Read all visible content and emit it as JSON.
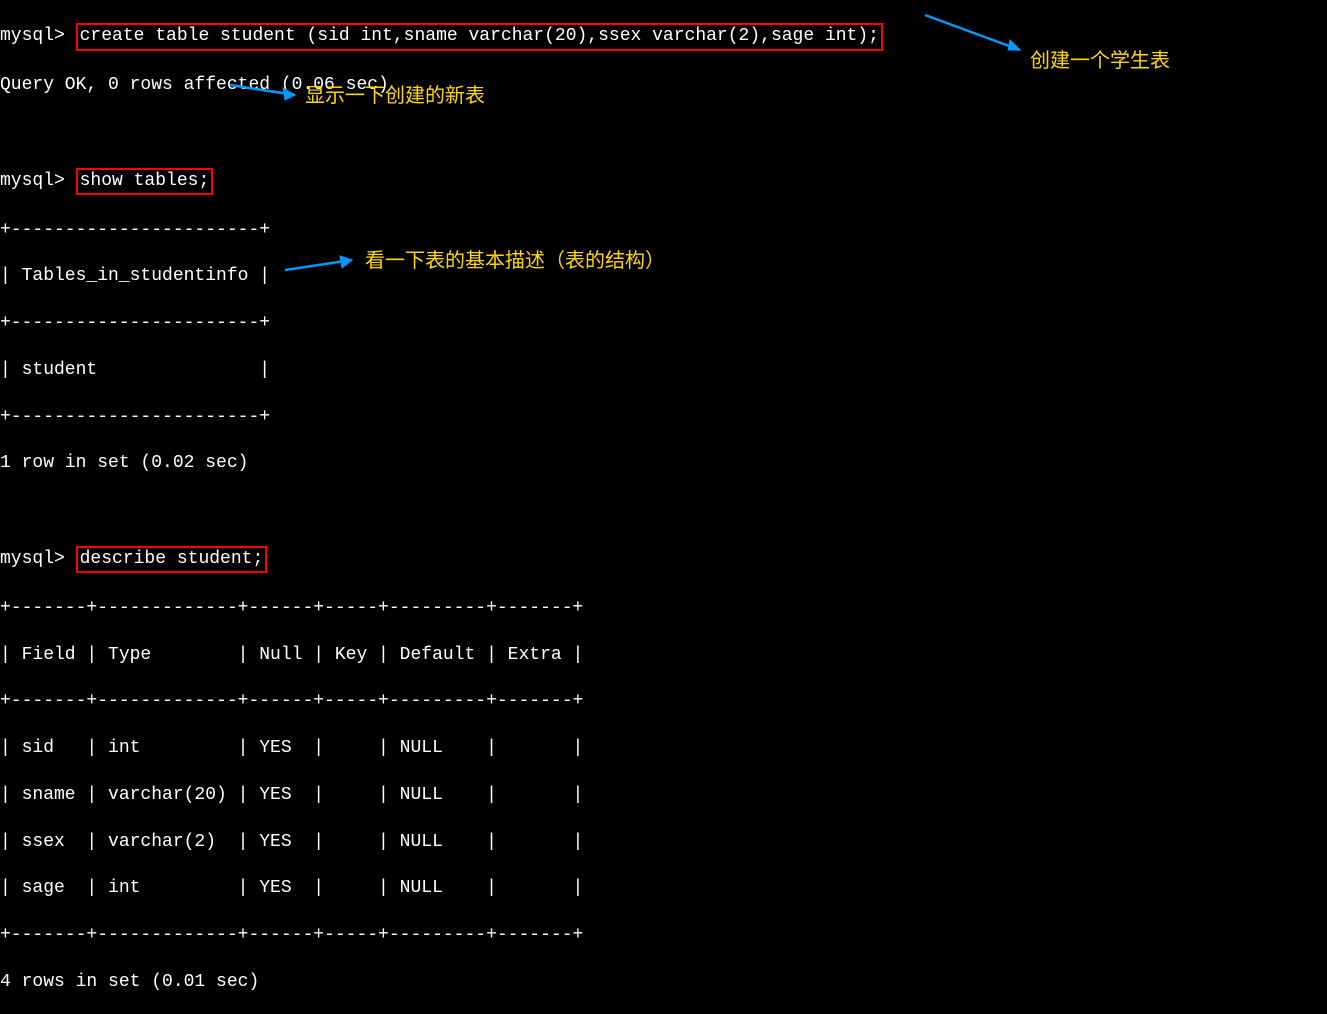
{
  "prompt": "mysql>",
  "space": " ",
  "commands": {
    "create_cmd": "create table student (sid int,sname varchar(20),ssex varchar(2),sage int);",
    "show_cmd": "show tables;",
    "describe_cmd": "describe student;"
  },
  "results": {
    "create_ok": "Query OK, 0 rows affected (0.06 sec)",
    "tables_border": "+-----------------------+",
    "tables_header_row": "| Tables_in_studentinfo |",
    "tables_data_row": "| student               |",
    "show_summary": "1 row in set (0.02 sec)",
    "desc_border": "+-------+-------------+------+-----+---------+-------+",
    "desc_header": "| Field | Type        | Null | Key | Default | Extra |",
    "desc_row1": "| sid   | int         | YES  |     | NULL    |       |",
    "desc_row2": "| sname | varchar(20) | YES  |     | NULL    |       |",
    "desc_row3": "| ssex  | varchar(2)  | YES  |     | NULL    |       |",
    "desc_row4": "| sage  | int         | YES  |     | NULL    |       |",
    "desc_summary": "4 rows in set (0.01 sec)"
  },
  "annotations": {
    "create_note": "创建一个学生表",
    "show_note": "显示一下创建的新表",
    "desc_note": "看一下表的基本描述（表的结构）"
  },
  "chart_data": {
    "type": "table",
    "title": "describe student",
    "columns": [
      "Field",
      "Type",
      "Null",
      "Key",
      "Default",
      "Extra"
    ],
    "rows": [
      [
        "sid",
        "int",
        "YES",
        "",
        "NULL",
        ""
      ],
      [
        "sname",
        "varchar(20)",
        "YES",
        "",
        "NULL",
        ""
      ],
      [
        "ssex",
        "varchar(2)",
        "YES",
        "",
        "NULL",
        ""
      ],
      [
        "sage",
        "int",
        "YES",
        "",
        "NULL",
        ""
      ]
    ],
    "tables_in_studentinfo": [
      "student"
    ]
  }
}
